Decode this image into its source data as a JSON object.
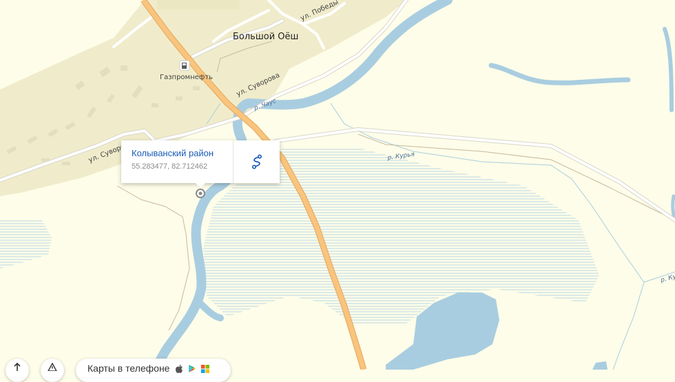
{
  "map": {
    "village_name": "Большой Оёш",
    "streets": {
      "pobedy": "ул. Победы",
      "suvorova_upper": "ул. Суворова",
      "suvorova_lower": "ул. Суворова"
    },
    "poi": {
      "gas_station": "Газпромнефть"
    },
    "rivers": {
      "chaus": "р. Чаус",
      "kurya": "р. Курья",
      "kurya_right": "р. Курья"
    },
    "colors": {
      "land": "#fdfde9",
      "settlement": "#f0eccb",
      "water": "#a9cde0",
      "road_main": "#f8c47e",
      "road_main_edge": "#e6a659",
      "road_minor": "#ffffff",
      "popup_link": "#1a5bb5"
    }
  },
  "popup": {
    "title": "Колыванский район",
    "coords": "55.283477, 82.712462",
    "route_icon": "route-icon"
  },
  "controls": {
    "up_icon": "arrow-up-icon",
    "warning_icon": "warning-icon",
    "promo_text": "Карты в телефоне",
    "store_icons": [
      "apple-icon",
      "google-play-icon",
      "windows-icon"
    ]
  }
}
